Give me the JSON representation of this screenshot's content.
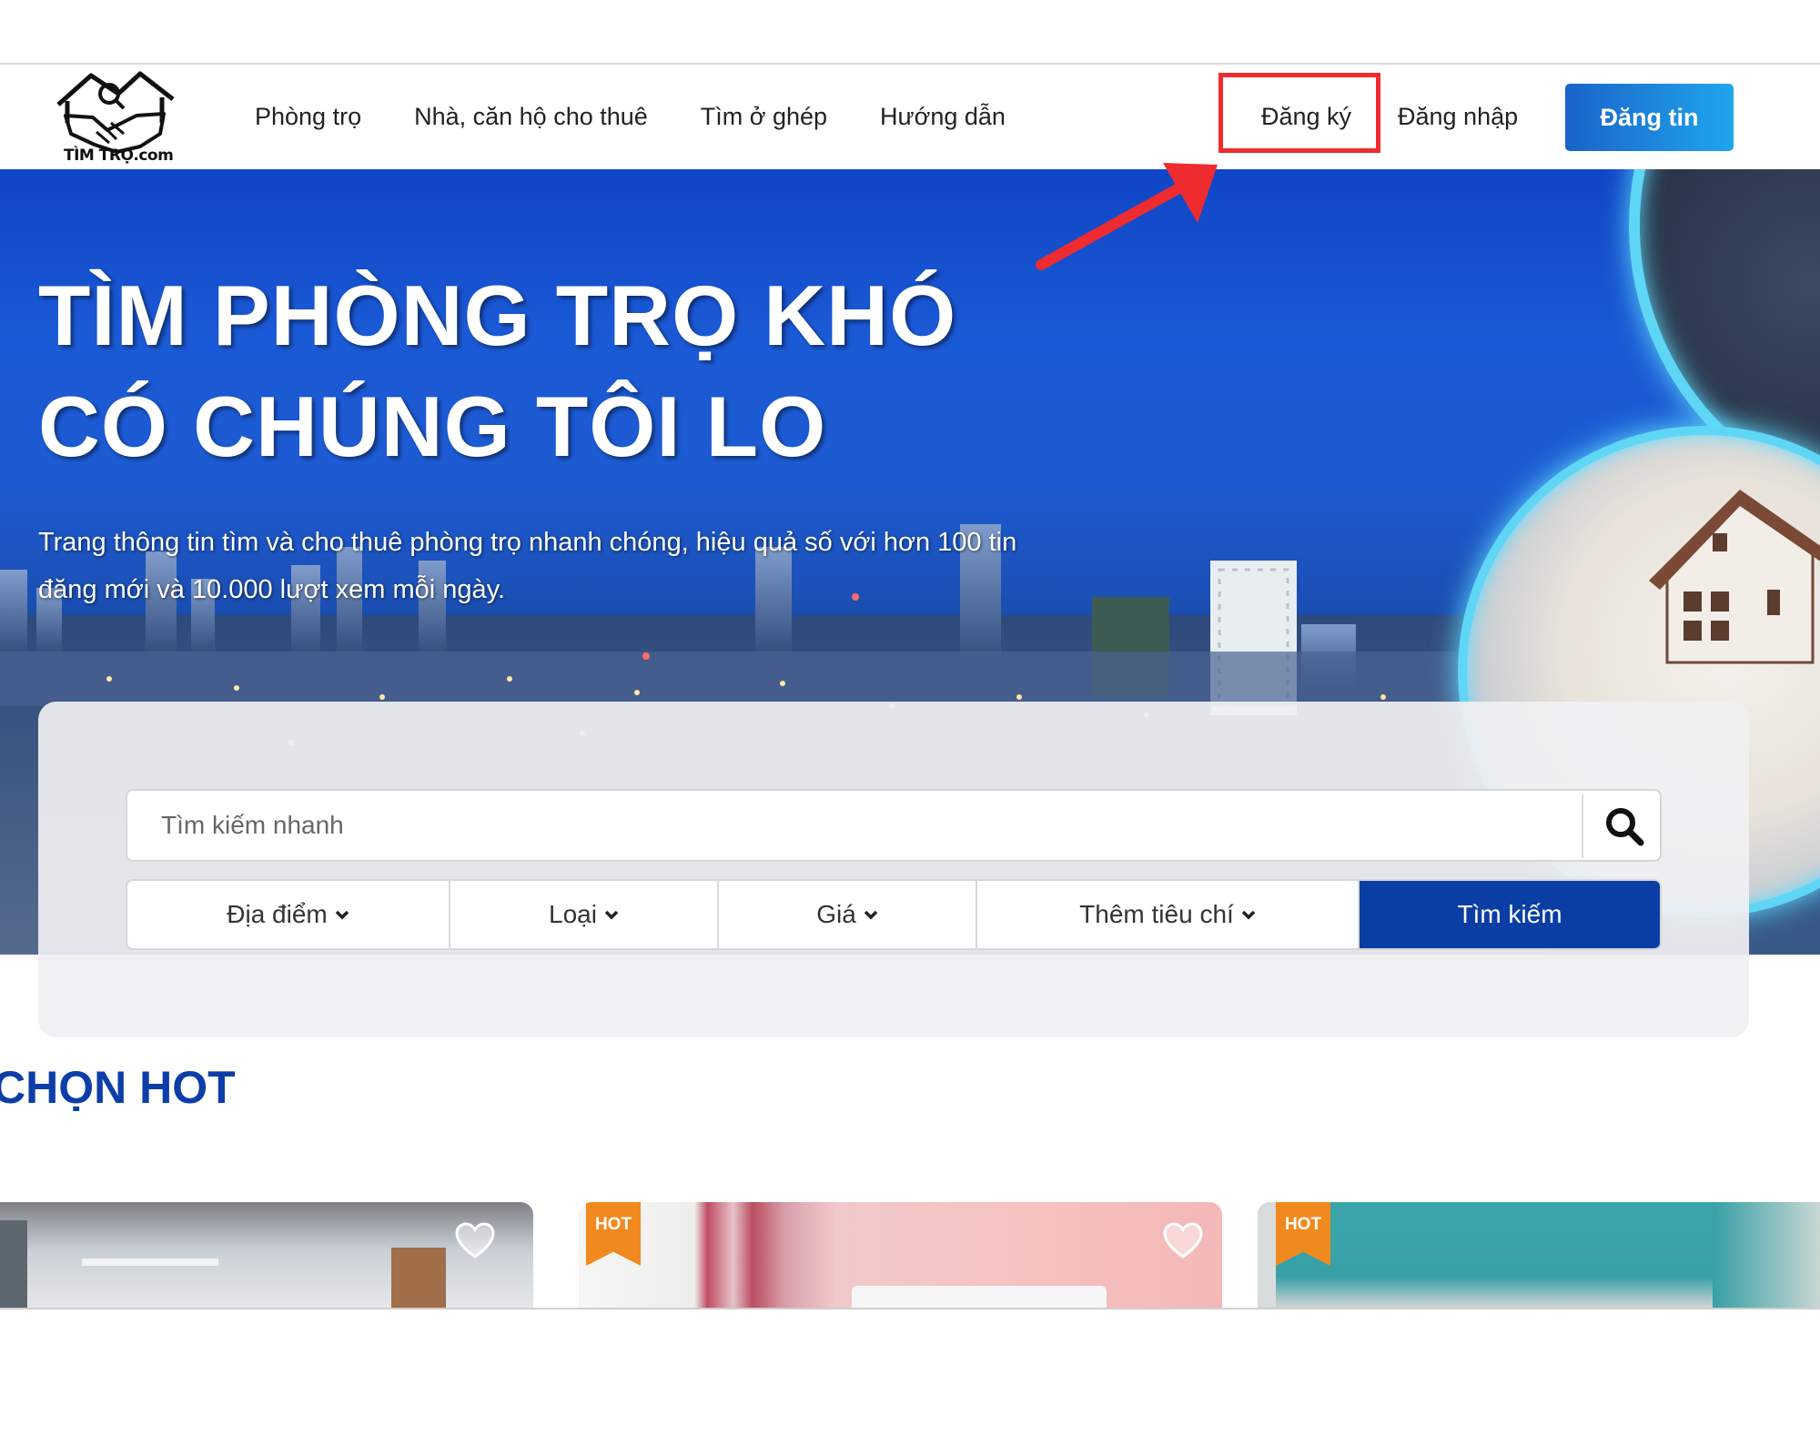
{
  "header": {
    "logo_text": "TÌM TRỌ.com",
    "nav": [
      "Phòng trọ",
      "Nhà, căn hộ cho thuê",
      "Tìm ở ghép",
      "Hướng dẫn"
    ],
    "register": "Đăng ký",
    "login": "Đăng nhập",
    "post_button": "Đăng tin"
  },
  "hero": {
    "title_line1": "TÌM PHÒNG TRỌ KHÓ",
    "title_line2": "CÓ CHÚNG TÔI LO",
    "description": "Trang thông tin tìm và cho thuê phòng trọ nhanh chóng, hiệu quả số với hơn 100 tin đăng mới và 10.000 lượt xem mỗi ngày."
  },
  "search": {
    "placeholder": "Tìm kiếm nhanh",
    "filters": [
      "Địa điểm",
      "Loại",
      "Giá",
      "Thêm tiêu chí"
    ],
    "submit": "Tìm kiếm"
  },
  "section": {
    "title": "CHỌN HOT"
  },
  "cards": [
    {
      "badge": ""
    },
    {
      "badge": "HOT"
    },
    {
      "badge": "HOT"
    }
  ],
  "colors": {
    "brand_blue": "#0a3ea5",
    "post_gradient_start": "#1a63c9",
    "post_gradient_end": "#1fa6ec",
    "highlight_red": "#ee2b2f",
    "hot_badge": "#f08a1e",
    "neon_cyan": "#5fd6f5"
  },
  "icons": {
    "search": "search-icon",
    "chevron": "chevron-down-icon",
    "favorite": "heart-icon",
    "annotation": "arrow-annotation"
  }
}
